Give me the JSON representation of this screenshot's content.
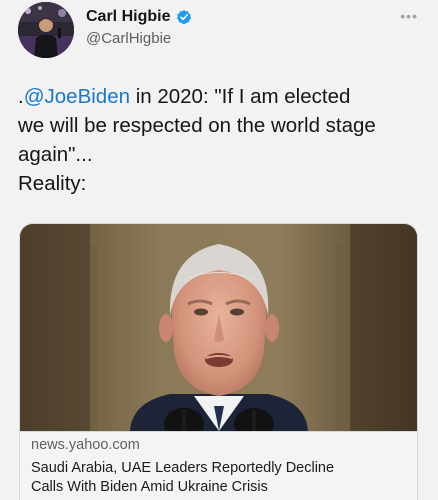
{
  "author": {
    "display_name": "Carl Higbie",
    "handle": "@CarlHigbie",
    "verified_color": "#1d9bf0"
  },
  "menu": {
    "more_label": "•••"
  },
  "tweet": {
    "mention": "@JoeBiden",
    "line1_prefix": ".",
    "line1_suffix": " in 2020: \"If I am elected",
    "line2": "we will be respected on the world stage",
    "line3": "again\"...",
    "line4": "Reality:"
  },
  "link_card": {
    "domain": "news.yahoo.com",
    "title_line1": "Saudi Arabia, UAE Leaders Reportedly Decline",
    "title_line2": "Calls With Biden Amid Ukraine Crisis"
  },
  "colors": {
    "link": "#1d76c9",
    "background": "#f2f2f2",
    "secondary_text": "#5a5f63"
  }
}
